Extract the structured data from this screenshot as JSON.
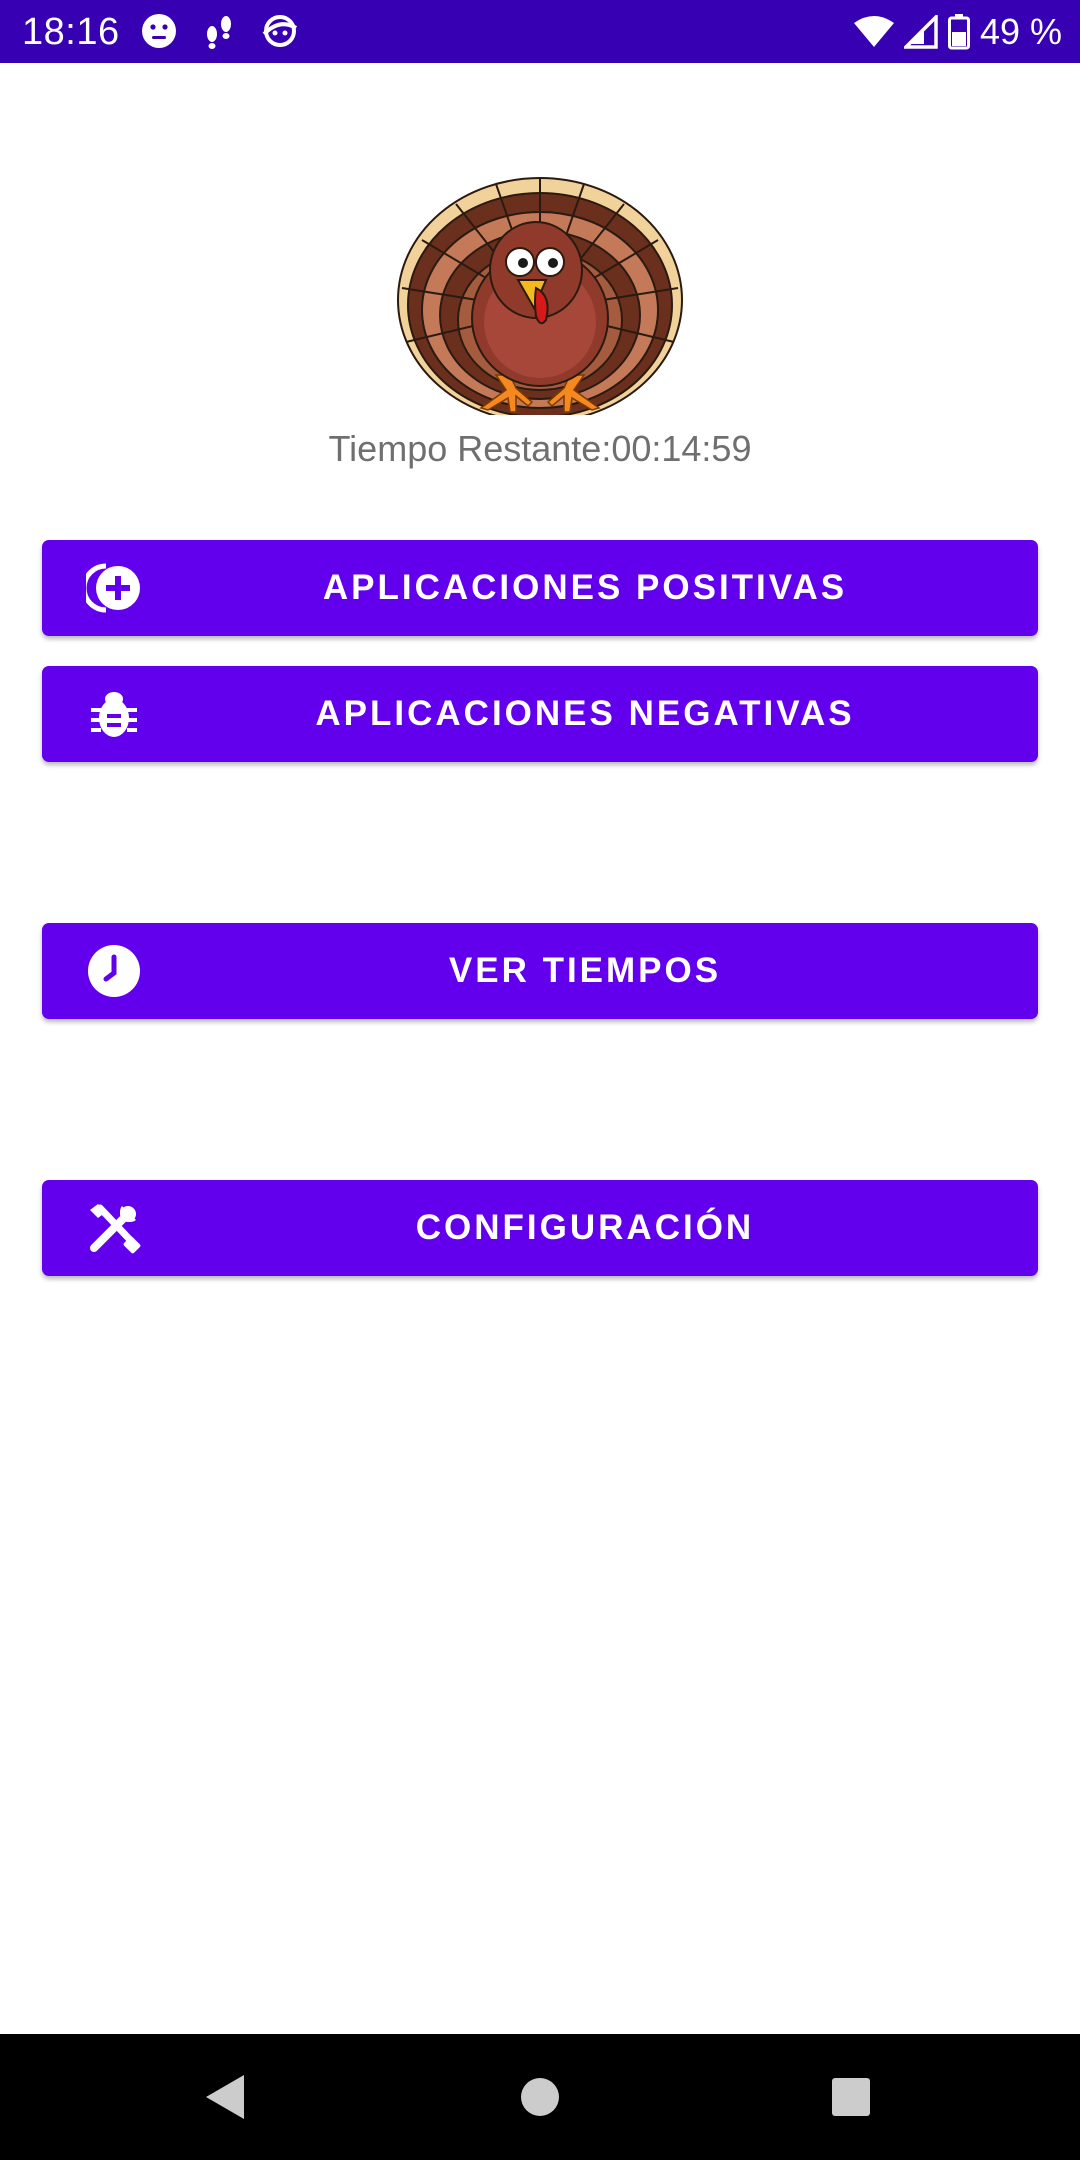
{
  "status_bar": {
    "time": "18:16",
    "left_icons": [
      "face-icon",
      "footprints-icon",
      "sync-face-icon"
    ],
    "battery_percent": "49 %",
    "background": "#3700b3"
  },
  "main": {
    "timer_text": "Tiempo Restante:00:14:59",
    "buttons": [
      {
        "label": "APLICACIONES POSITIVAS",
        "icon": "add-circle-icon"
      },
      {
        "label": "APLICACIONES NEGATIVAS",
        "icon": "bug-icon"
      },
      {
        "label": "VER TIEMPOS",
        "icon": "clock-icon"
      },
      {
        "label": "CONFIGURACIÓN",
        "icon": "tools-icon"
      }
    ],
    "button_color": "#6200ee"
  },
  "nav_bar": {
    "buttons": [
      "back-icon",
      "home-icon",
      "recents-icon"
    ]
  }
}
